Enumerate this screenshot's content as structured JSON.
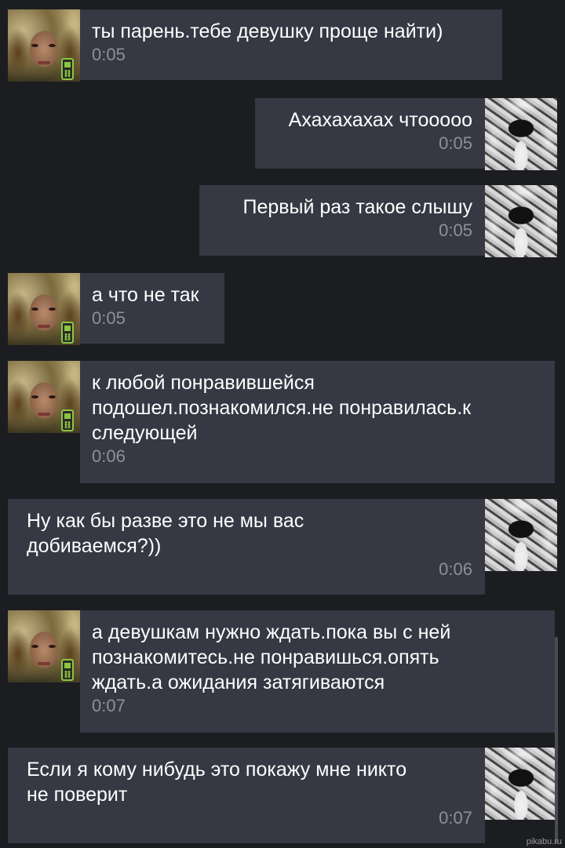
{
  "messages": [
    {
      "from": "her",
      "text": "ты парень.тебе девушку проще найти)",
      "time": "0:05"
    },
    {
      "from": "me",
      "text": "Ахахахахах чтооооо",
      "time": "0:05"
    },
    {
      "from": "me",
      "text": "Первый раз такое слышу",
      "time": "0:05"
    },
    {
      "from": "her",
      "text": "а что не так",
      "time": "0:05"
    },
    {
      "from": "her",
      "text": "к любой понравившейся\nподошел.познакомился.не понравилась.к\nследующей",
      "time": "0:06"
    },
    {
      "from": "me",
      "text": "Ну как бы разве это не мы вас\nдобиваемся?))",
      "time": "0:06"
    },
    {
      "from": "her",
      "text": "а девушкам нужно ждать.пока вы с ней\nпознакомитесь.не понравишься.опять\nждать.а ожидания затягиваются",
      "time": "0:07"
    },
    {
      "from": "me",
      "text": "Если я кому нибудь это покажу мне никто\nне поверит",
      "time": "0:07"
    }
  ],
  "icons": {
    "her_status": "mobile-phone-icon"
  },
  "watermark": "pikabu.ru"
}
